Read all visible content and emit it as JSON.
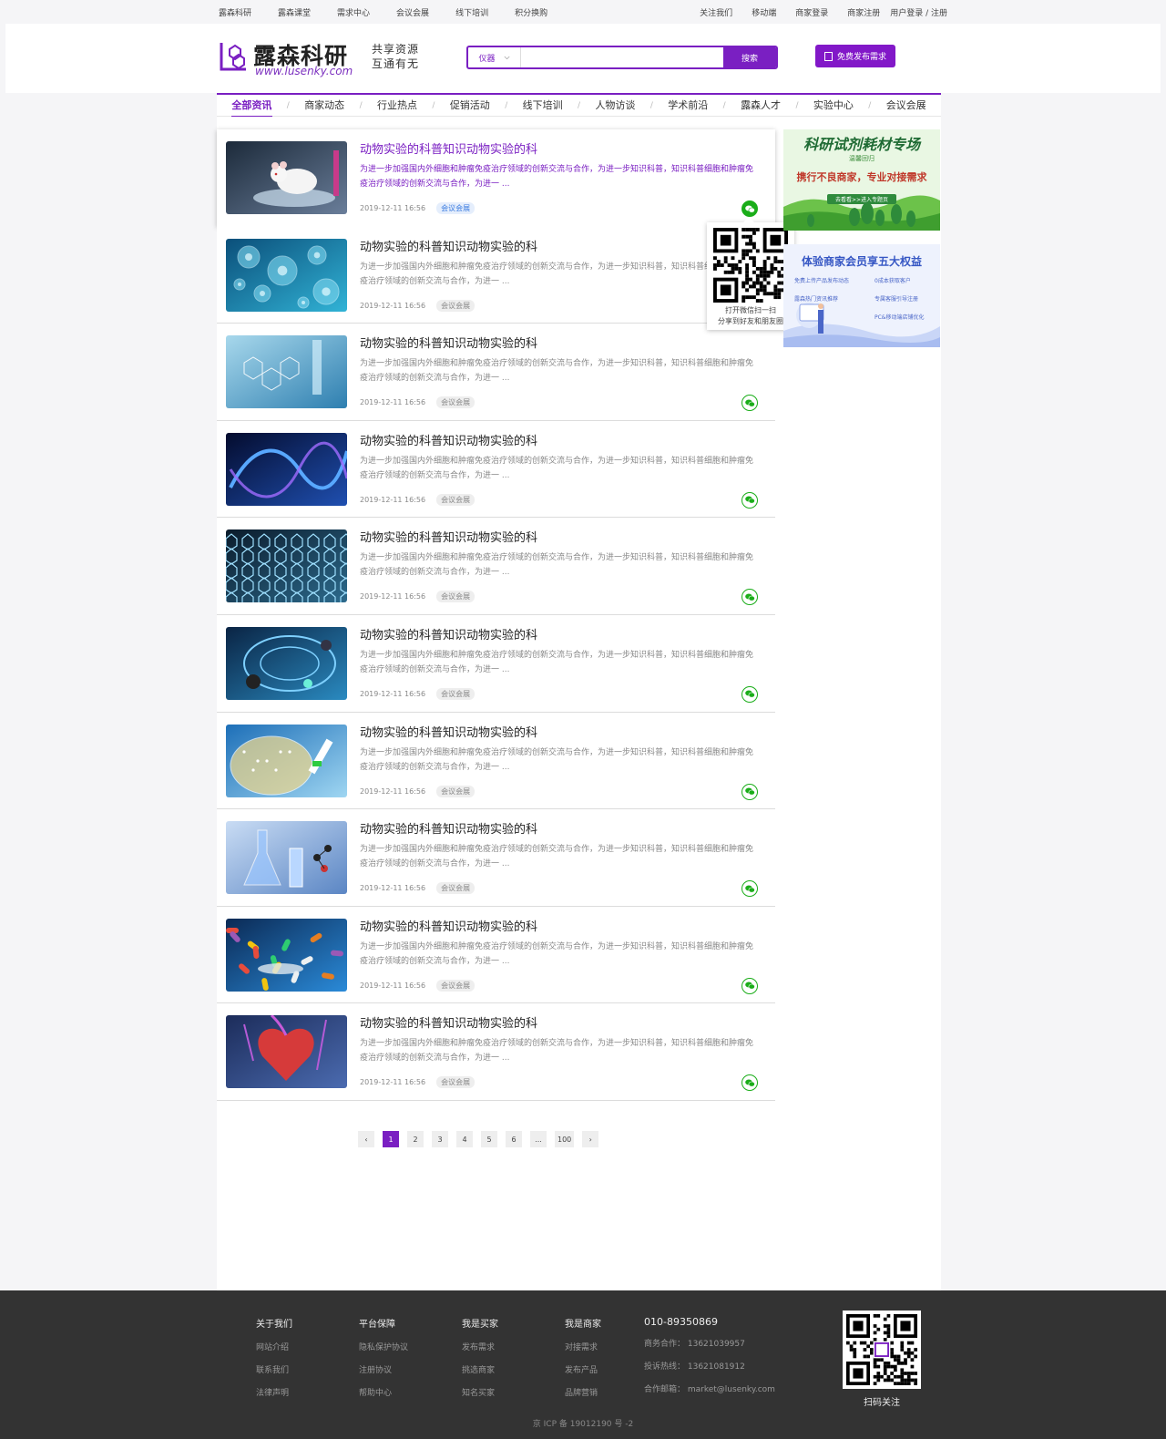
{
  "topbar": {
    "left_links": [
      "露森科研",
      "露森课堂",
      "需求中心",
      "会议会展",
      "线下培训",
      "积分换购"
    ],
    "follow": "关注我们",
    "mobile": "移动端",
    "merchant_login": "商家登录",
    "merchant_register": "商家注册",
    "user_login": "用户登录 / 注册"
  },
  "header": {
    "logo_cn": "露森科研",
    "logo_en": "www.lusenky.com",
    "slogan_1": "共享资源",
    "slogan_2": "互通有无",
    "search_category": "仪器",
    "search_placeholder": "",
    "search_button": "搜索",
    "publish_button": "免费发布需求"
  },
  "nav": {
    "items": [
      "全部资讯",
      "商家动态",
      "行业热点",
      "促销活动",
      "线下培训",
      "人物访谈",
      "学术前沿",
      "露森人才",
      "实验中心",
      "会议会展"
    ],
    "active_index": 0
  },
  "articles": [
    {
      "title": "动物实验的科普知识动物实验的科",
      "desc": "为进一步加强国内外细胞和肿瘤免疫治疗领域的创新交流与合作，为进一步知识科普，知识科普细胞和肿瘤免疫治疗领域的创新交流与合作，为进一 ...",
      "date": "2019-12-11  16:56",
      "tag": "会议会展",
      "image": "mouse"
    },
    {
      "title": "动物实验的科普知识动物实验的科",
      "desc": "为进一步加强国内外细胞和肿瘤免疫治疗领域的创新交流与合作，为进一步知识科普，知识科普细胞和肿瘤免疫治疗领域的创新交流与合作，为进一 ...",
      "date": "2019-12-11  16:56",
      "tag": "会议会展",
      "image": "cells"
    },
    {
      "title": "动物实验的科普知识动物实验的科",
      "desc": "为进一步加强国内外细胞和肿瘤免疫治疗领域的创新交流与合作，为进一步知识科普，知识科普细胞和肿瘤免疫治疗领域的创新交流与合作，为进一 ...",
      "date": "2019-12-11  16:56",
      "tag": "会议会展",
      "image": "molecule"
    },
    {
      "title": "动物实验的科普知识动物实验的科",
      "desc": "为进一步加强国内外细胞和肿瘤免疫治疗领域的创新交流与合作，为进一步知识科普，知识科普细胞和肿瘤免疫治疗领域的创新交流与合作，为进一 ...",
      "date": "2019-12-11  16:56",
      "tag": "会议会展",
      "image": "dna"
    },
    {
      "title": "动物实验的科普知识动物实验的科",
      "desc": "为进一步加强国内外细胞和肿瘤免疫治疗领域的创新交流与合作，为进一步知识科普，知识科普细胞和肿瘤免疫治疗领域的创新交流与合作，为进一 ...",
      "date": "2019-12-11  16:56",
      "tag": "会议会展",
      "image": "graphene"
    },
    {
      "title": "动物实验的科普知识动物实验的科",
      "desc": "为进一步加强国内外细胞和肿瘤免疫治疗领域的创新交流与合作，为进一步知识科普，知识科普细胞和肿瘤免疫治疗领域的创新交流与合作，为进一 ...",
      "date": "2019-12-11  16:56",
      "tag": "会议会展",
      "image": "nanotube"
    },
    {
      "title": "动物实验的科普知识动物实验的科",
      "desc": "为进一步加强国内外细胞和肿瘤免疫治疗领域的创新交流与合作，为进一步知识科普，知识科普细胞和肿瘤免疫治疗领域的创新交流与合作，为进一 ...",
      "date": "2019-12-11  16:56",
      "tag": "会议会展",
      "image": "petri"
    },
    {
      "title": "动物实验的科普知识动物实验的科",
      "desc": "为进一步加强国内外细胞和肿瘤免疫治疗领域的创新交流与合作，为进一步知识科普，知识科普细胞和肿瘤免疫治疗领域的创新交流与合作，为进一 ...",
      "date": "2019-12-11  16:56",
      "tag": "会议会展",
      "image": "flasks"
    },
    {
      "title": "动物实验的科普知识动物实验的科",
      "desc": "为进一步加强国内外细胞和肿瘤免疫治疗领域的创新交流与合作，为进一步知识科普，知识科普细胞和肿瘤免疫治疗领域的创新交流与合作，为进一 ...",
      "date": "2019-12-11  16:56",
      "tag": "会议会展",
      "image": "pills"
    },
    {
      "title": "动物实验的科普知识动物实验的科",
      "desc": "为进一步加强国内外细胞和肿瘤免疫治疗领域的创新交流与合作，为进一步知识科普，知识科普细胞和肿瘤免疫治疗领域的创新交流与合作，为进一 ...",
      "date": "2019-12-11  16:56",
      "tag": "会议会展",
      "image": "heart"
    }
  ],
  "qr_popup": {
    "line1": "打开微信扫一扫",
    "line2": "分享到好友和朋友圈"
  },
  "banners": {
    "b1_title": "科研试剂耗材专场",
    "b1_sub": "温馨回归",
    "b1_line": "携行不良商家，专业对接需求",
    "b1_btn": "去看看>>进入专题页",
    "b2_title": "体验商家会员享五大权益",
    "b2_items": [
      "免费上传产品发布动态",
      "0成本获取客户",
      "露森热门资讯推荐",
      "专属客服引导注册",
      "PC&移动端店铺优化"
    ]
  },
  "pagination": {
    "prev": "‹",
    "pages": [
      "1",
      "2",
      "3",
      "4",
      "5",
      "6",
      "...",
      "100"
    ],
    "active": "1",
    "next": "›"
  },
  "footer": {
    "cols": [
      {
        "title": "关于我们",
        "links": [
          "网站介绍",
          "联系我们",
          "法律声明"
        ]
      },
      {
        "title": "平台保障",
        "links": [
          "隐私保护协议",
          "注册协议",
          "帮助中心"
        ]
      },
      {
        "title": "我是买家",
        "links": [
          "发布需求",
          "挑选商家",
          "知名买家"
        ]
      },
      {
        "title": "我是商家",
        "links": [
          "对接需求",
          "发布产品",
          "品牌营销"
        ]
      }
    ],
    "phone": "010-89350869",
    "biz": "商务合作：  13621039957",
    "complaint": "投诉热线：  13621081912",
    "email": "合作邮箱：   market@lusenky.com",
    "qr_label": "扫码关注",
    "icp": "京 ICP 备 19012190 号 -2"
  },
  "colors": {
    "brand_purple": "#7a1fc2",
    "wechat_green": "#1aad19",
    "footer_bg": "#333333"
  }
}
